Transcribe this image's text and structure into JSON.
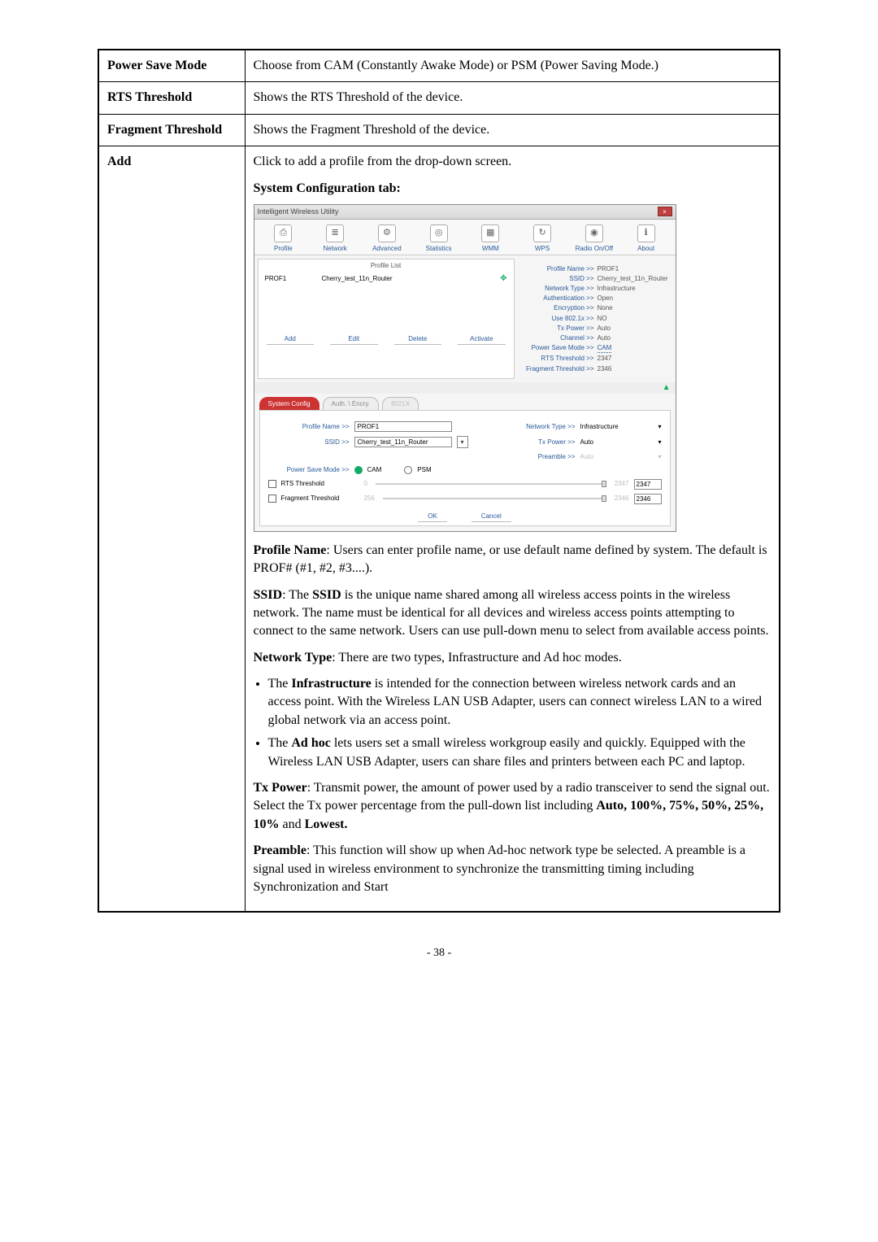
{
  "rows": {
    "power_save_mode": {
      "label": "Power Save Mode",
      "desc": "Choose from CAM (Constantly Awake Mode) or PSM (Power Saving Mode.)"
    },
    "rts_threshold": {
      "label": "RTS Threshold",
      "desc": "Shows the RTS Threshold of the device."
    },
    "fragment_threshold": {
      "label": "Fragment Threshold",
      "desc": "Shows the Fragment Threshold of the device."
    },
    "add": {
      "label": "Add",
      "desc": "Click to add a profile from the drop-down screen.",
      "heading": "System Configuration tab:",
      "profile_name_label": "Profile Name",
      "profile_name_text": ": Users can enter profile name, or use default name defined by system. The default is PROF# (#1, #2, #3....).",
      "ssid_label": "SSID",
      "ssid_text_1": ": The ",
      "ssid_bold": "SSID",
      "ssid_text_2": " is the unique name shared among all wireless access points in the wireless network. The name must be identical for all devices and wireless access points attempting to connect to the same network. Users can use pull-down menu to select from available access points.",
      "network_type_label": "Network Type",
      "network_type_text": ": There are two types, Infrastructure and Ad hoc modes.",
      "infra_pre": "The ",
      "infra_bold": "Infrastructure",
      "infra_text": " is intended for the connection between wireless network cards and an access point. With the Wireless LAN USB Adapter, users can connect wireless LAN to a wired global network via an access point.",
      "adhoc_pre": "The ",
      "adhoc_bold": "Ad hoc",
      "adhoc_text": " lets users set a small wireless workgroup easily and quickly. Equipped with the Wireless LAN USB Adapter, users can share files and printers between each PC and laptop.",
      "tx_label": "Tx Power",
      "tx_text_1": ": Transmit power, the amount of power used by a radio transceiver to send the signal out. Select the Tx power percentage from the pull-down list including ",
      "tx_bold": "Auto, 100%, 75%, 50%, 25%, 10%",
      "tx_text_2": " and ",
      "tx_bold2": "Lowest.",
      "preamble_label": "Preamble",
      "preamble_text": ": This function will show up when Ad-hoc network type be selected. A preamble is a signal used in wireless environment to synchronize the transmitting timing including Synchronization and Start"
    }
  },
  "app": {
    "title": "Intelligent Wireless Utility",
    "close": "×",
    "toolbar": {
      "profile": "Profile",
      "network": "Network",
      "advanced": "Advanced",
      "statistics": "Statistics",
      "wmm": "WMM",
      "wps": "WPS",
      "radio": "Radio On/Off",
      "about": "About"
    },
    "profile_list": {
      "title": "Profile List",
      "name": "PROF1",
      "ssid": "Cherry_test_11n_Router",
      "buttons": {
        "add": "Add",
        "edit": "Edit",
        "delete": "Delete",
        "activate": "Activate"
      }
    },
    "details": {
      "profile_name_label": "Profile Name >>",
      "profile_name": "PROF1",
      "ssid_label": "SSID >>",
      "ssid": "Cherry_test_11n_Router",
      "net_type_label": "Network Type >>",
      "net_type": "Infrastructure",
      "auth_label": "Authentication >>",
      "auth": "Open",
      "enc_label": "Encryption >>",
      "enc": "None",
      "use8021x_label": "Use 802.1x >>",
      "use8021x": "NO",
      "txpower_label": "Tx Power >>",
      "txpower": "Auto",
      "channel_label": "Channel >>",
      "channel": "Auto",
      "psm_label": "Power Save Mode >>",
      "psm": "CAM",
      "rts_label": "RTS Threshold >>",
      "rts": "2347",
      "frag_label": "Fragment Threshold >>",
      "frag": "2346"
    },
    "tabs": {
      "system": "System Config",
      "auth": "Auth. \\ Encry.",
      "x8021": "8021X"
    },
    "config": {
      "profile_name_label": "Profile Name >>",
      "profile_name": "PROF1",
      "ssid_label": "SSID >>",
      "ssid": "Cherry_test_11n_Router",
      "net_type_label": "Network Type >>",
      "net_type": "Infrastructure",
      "tx_label": "Tx Power >>",
      "tx": "Auto",
      "preamble_label": "Preamble >>",
      "preamble": "Auto",
      "psm_label": "Power Save Mode >>",
      "cam": "CAM",
      "psm": "PSM",
      "rts_chk": "RTS Threshold",
      "rts_min": "0",
      "rts_max_grey": "2347",
      "rts_val": "2347",
      "frag_chk": "Fragment Threshold",
      "frag_min": "256",
      "frag_max_grey": "2346",
      "frag_val": "2346",
      "ok": "OK",
      "cancel": "Cancel"
    }
  },
  "page_number": "- 38 -"
}
